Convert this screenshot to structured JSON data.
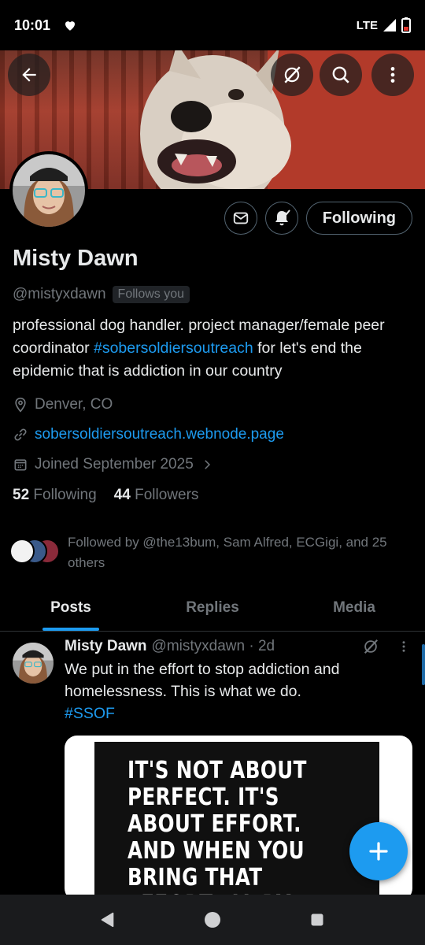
{
  "status_bar": {
    "time": "10:01",
    "network": "LTE"
  },
  "profile": {
    "name": "Misty Dawn",
    "handle": "@mistyxdawn",
    "follows_you_badge": "Follows you",
    "bio_part1": "professional dog handler. project manager/female peer coordinator ",
    "bio_hashtag": "#sobersoldiersoutreach",
    "bio_part2": " for let's end the epidemic that is addiction in our country",
    "location": "Denver, CO",
    "website": "sobersoldiersoutreach.webnode.page",
    "joined": "Joined September 2025",
    "following_count": "52",
    "following_label": "Following",
    "followers_count": "44",
    "followers_label": "Followers",
    "following_button": "Following",
    "followed_by": "Followed by @the13bum, Sam Alfred, ECGigi, and 25 others"
  },
  "tabs": [
    {
      "label": "Posts",
      "active": true
    },
    {
      "label": "Replies",
      "active": false
    },
    {
      "label": "Media",
      "active": false
    }
  ],
  "post": {
    "author": "Misty Dawn",
    "handle_time": "@mistyxdawn · 2d",
    "text": "We put in the effort to stop addiction and homelessness. This is what we do.",
    "hashtag": "#SSOF",
    "image_text": "IT'S NOT ABOUT\nPERFECT. IT'S\nABOUT EFFORT.\nAND WHEN YOU\nBRING THAT\nEFFORT EVERY"
  },
  "colors": {
    "accent": "#1d9bf0",
    "muted": "#71767b",
    "text": "#e7e9ea",
    "background": "#000000"
  }
}
